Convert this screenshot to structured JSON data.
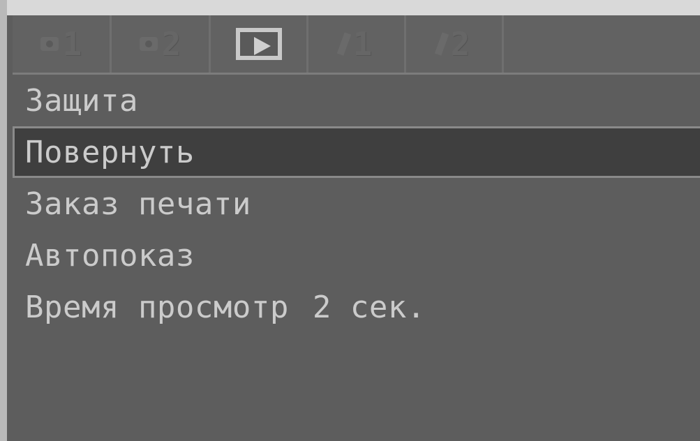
{
  "tabs": [
    {
      "label": "1",
      "icon": "camera-icon",
      "active": false
    },
    {
      "label": "2",
      "icon": "camera-icon",
      "active": false
    },
    {
      "label": "",
      "icon": "play-icon",
      "active": true
    },
    {
      "label": "1",
      "icon": "setup-icon",
      "active": false
    },
    {
      "label": "2",
      "icon": "setup-icon",
      "active": false
    }
  ],
  "menu": {
    "items": [
      {
        "label": "Защита",
        "value": ""
      },
      {
        "label": "Повернуть",
        "value": ""
      },
      {
        "label": "Заказ печати",
        "value": ""
      },
      {
        "label": "Автопоказ",
        "value": ""
      },
      {
        "label": "Время просмотр",
        "value": "2 сек."
      }
    ],
    "selected_index": 1
  },
  "colors": {
    "text": "#cbcbcb",
    "highlight": "#3f3f3f",
    "background": "#5d5d5d"
  }
}
